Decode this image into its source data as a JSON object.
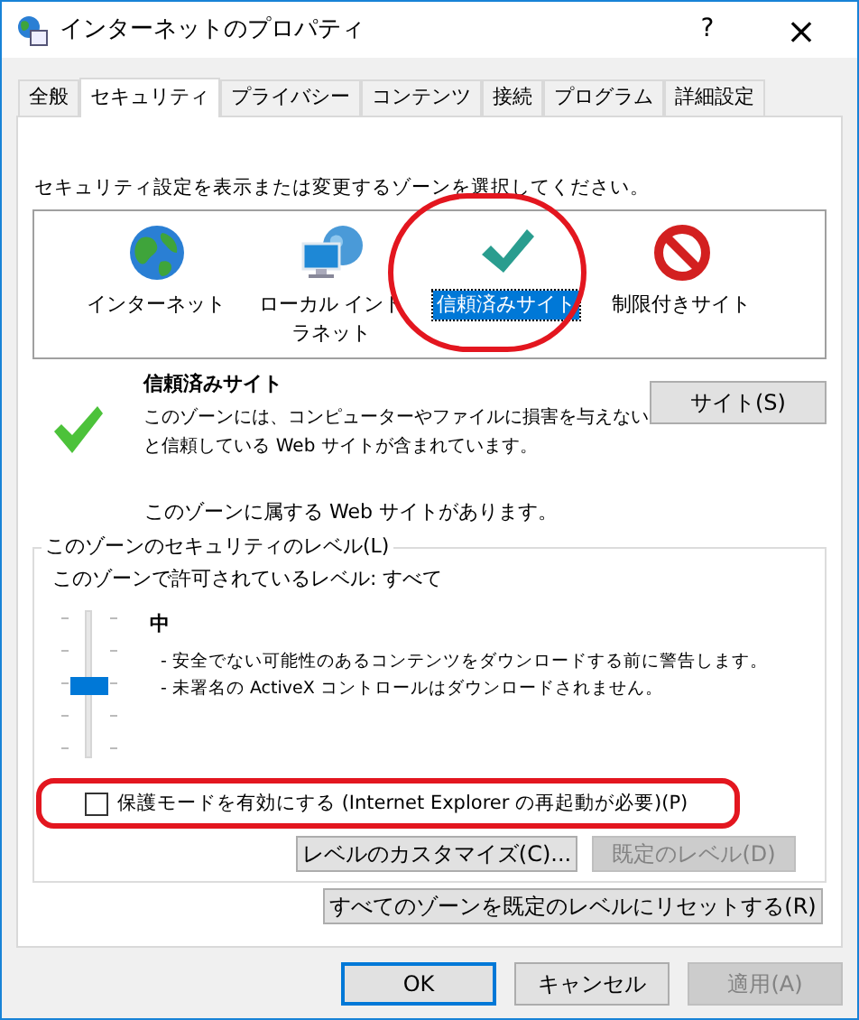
{
  "window": {
    "title": "インターネットのプロパティ",
    "help": "?",
    "close": "×"
  },
  "tabs": [
    {
      "label": "全般",
      "selected": false
    },
    {
      "label": "セキュリティ",
      "selected": true
    },
    {
      "label": "プライバシー",
      "selected": false
    },
    {
      "label": "コンテンツ",
      "selected": false
    },
    {
      "label": "接続",
      "selected": false
    },
    {
      "label": "プログラム",
      "selected": false
    },
    {
      "label": "詳細設定",
      "selected": false
    }
  ],
  "zone_prompt": "セキュリティ設定を表示または変更するゾーンを選択してください。",
  "zones": [
    {
      "label": "インターネット",
      "kind": "globe",
      "selected": false
    },
    {
      "label": "ローカル イントラネット",
      "kind": "intranet",
      "selected": false
    },
    {
      "label": "信頼済みサイト",
      "kind": "check",
      "selected": true
    },
    {
      "label": "制限付きサイト",
      "kind": "blocked",
      "selected": false
    }
  ],
  "zone_info": {
    "title": "信頼済みサイト",
    "description": "このゾーンには、コンピューターやファイルに損害を与えないと信頼している Web サイトが含まれています。",
    "sites_button": "サイト(S)",
    "note": "このゾーンに属する Web サイトがあります。"
  },
  "security_level": {
    "legend": "このゾーンのセキュリティのレベル(L)",
    "allowed": "このゾーンで許可されているレベル: すべて",
    "level": 0.5,
    "level_name": "中",
    "details": [
      "- 安全でない可能性のあるコンテンツをダウンロードする前に警告します。",
      "- 未署名の ActiveX コントロールはダウンロードされません。"
    ],
    "protected_mode": {
      "label": "保護モードを有効にする (Internet Explorer の再起動が必要)(P)",
      "checked": false
    },
    "buttons": [
      {
        "label": "レベルのカスタマイズ(C)...",
        "disabled": false
      },
      {
        "label": "既定のレベル(D)",
        "disabled": true
      }
    ]
  },
  "reset_button": "すべてのゾーンを既定のレベルにリセットする(R)",
  "buttons": [
    {
      "label": "OK",
      "default": true,
      "disabled": false
    },
    {
      "label": "キャンセル",
      "default": false,
      "disabled": false
    },
    {
      "label": "適用(A)",
      "default": false,
      "disabled": true
    }
  ]
}
